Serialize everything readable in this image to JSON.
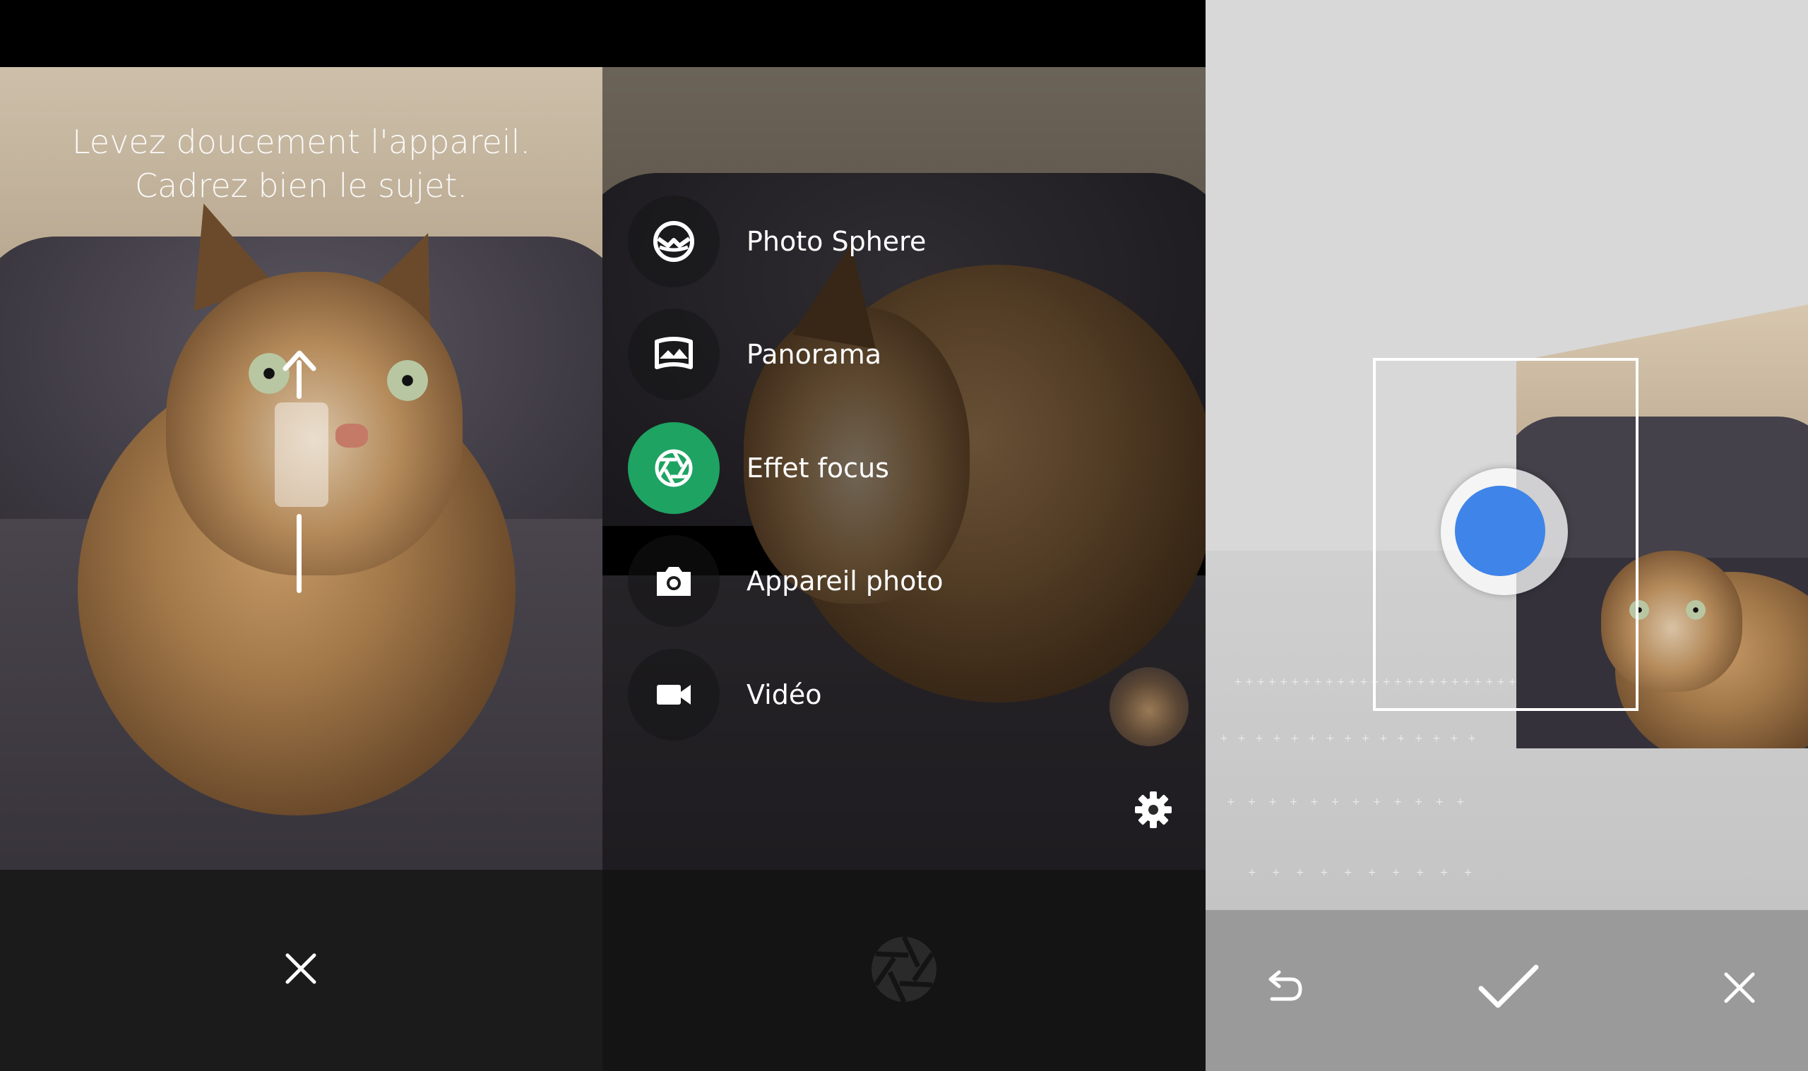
{
  "panel1": {
    "hint_line1": "Levez doucement l'appareil.",
    "hint_line2": "Cadrez bien le sujet.",
    "close_icon": "close-icon"
  },
  "panel2": {
    "modes": [
      {
        "label": "Photo Sphere",
        "icon": "photo-sphere-icon",
        "active": false
      },
      {
        "label": "Panorama",
        "icon": "panorama-icon",
        "active": false
      },
      {
        "label": "Effet focus",
        "icon": "aperture-icon",
        "active": true
      },
      {
        "label": "Appareil photo",
        "icon": "camera-icon",
        "active": false
      },
      {
        "label": "Vidéo",
        "icon": "video-icon",
        "active": false
      }
    ],
    "colors": {
      "active": "#1ea362"
    }
  },
  "panel3": {
    "undo_icon": "undo-icon",
    "confirm_icon": "check-icon",
    "cancel_icon": "close-icon",
    "colors": {
      "target_dot": "#3f84e8"
    }
  }
}
